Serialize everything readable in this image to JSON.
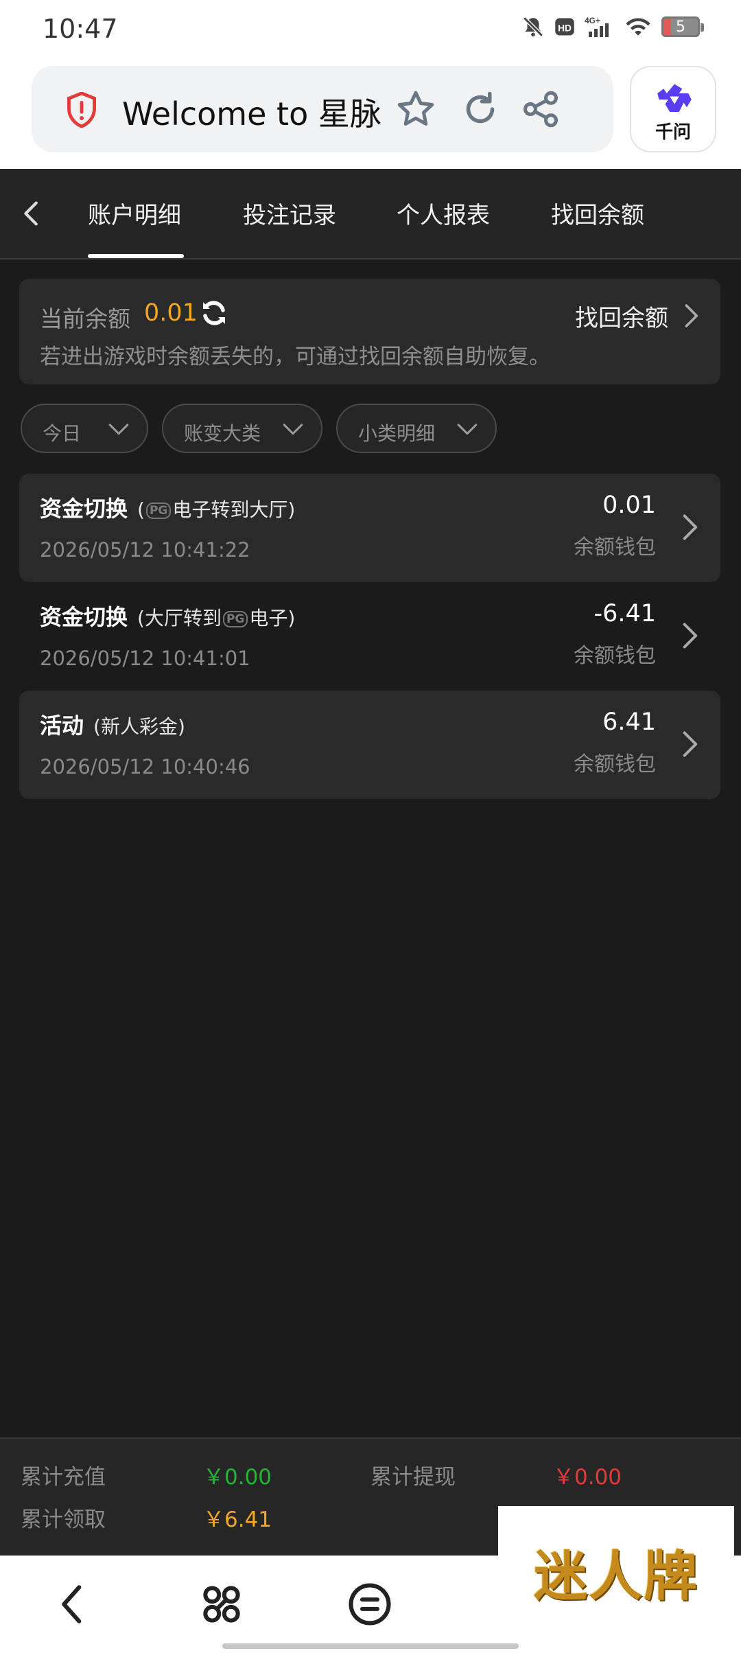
{
  "status_bar": {
    "time": "10:47",
    "network": "4G+",
    "battery": "5"
  },
  "browser": {
    "url_title": "Welcome to 星脉",
    "assistant_label": "千问"
  },
  "tabs": [
    "账户明细",
    "投注记录",
    "个人报表",
    "找回余额"
  ],
  "balance": {
    "label": "当前余额",
    "value": "0.01",
    "recover_label": "找回余额",
    "note": "若进出游戏时余额丢失的，可通过找回余额自助恢复。"
  },
  "filters": [
    "今日",
    "账变大类",
    "小类明细"
  ],
  "records": [
    {
      "title": "资金切换",
      "sub_prefix": "(",
      "sub_suffix": "电子转到大厅)",
      "time": "2026/05/12 10:41:22",
      "amount": "0.01",
      "wallet": "余额钱包"
    },
    {
      "title": "资金切换",
      "sub_prefix": "(大厅转到",
      "sub_suffix": "电子)",
      "time": "2026/05/12 10:41:01",
      "amount": "-6.41",
      "wallet": "余额钱包"
    },
    {
      "title": "活动",
      "sub_prefix": "(新人彩金)",
      "sub_suffix": "",
      "time": "2026/05/12 10:40:46",
      "amount": "6.41",
      "wallet": "余额钱包"
    }
  ],
  "pg_logo": "PG",
  "summary": {
    "deposit_label": "累计充值",
    "deposit_value": "￥0.00",
    "withdraw_label": "累计提现",
    "withdraw_value": "￥0.00",
    "claim_label": "累计领取",
    "claim_value": "￥6.41"
  },
  "brand": "迷人牌",
  "colors": {
    "accent_orange": "#f5a623",
    "green": "#22b536",
    "red": "#e53a3a",
    "bg": "#1b1b1b"
  }
}
